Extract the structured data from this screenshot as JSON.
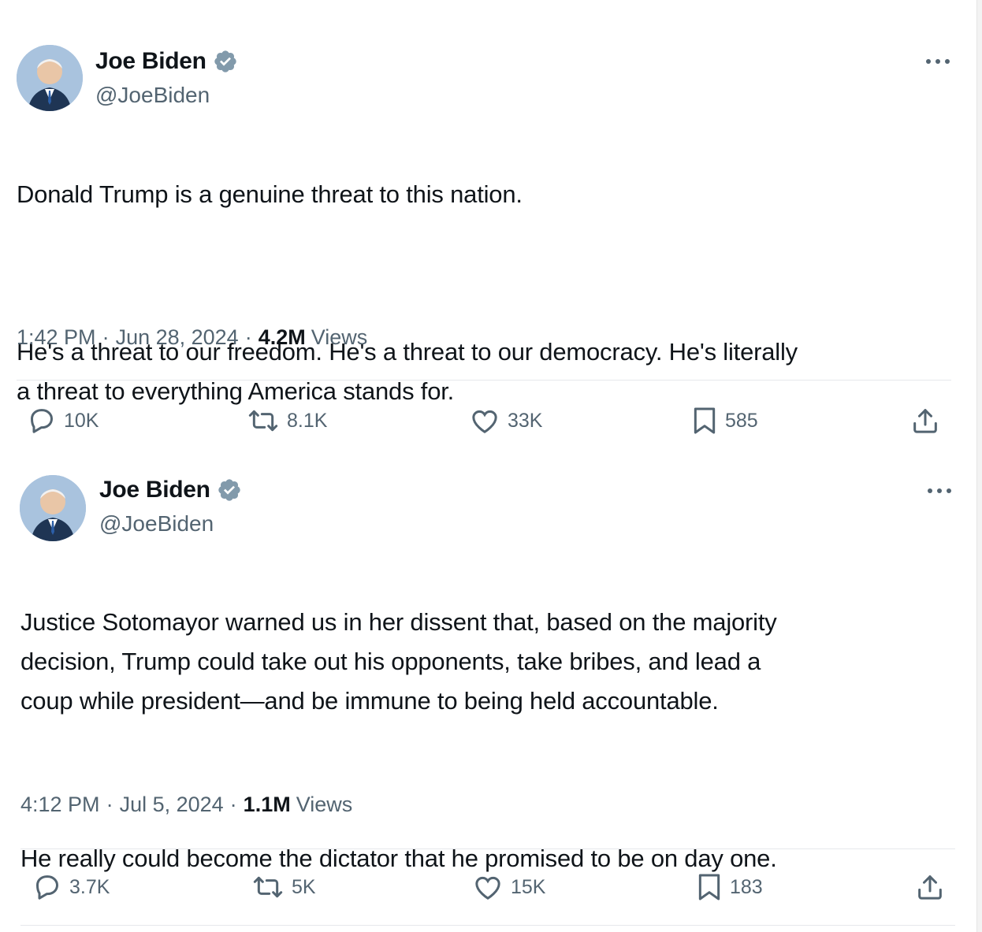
{
  "tweets": [
    {
      "author_name": "Joe Biden",
      "handle": "@JoeBiden",
      "paragraphs": [
        "Donald Trump is a genuine threat to this nation.",
        "He's a threat to our freedom. He's a threat to our democracy. He's literally\na threat to everything America stands for."
      ],
      "time": "1:42 PM",
      "date": "Jun 28, 2024",
      "views_count": "4.2M",
      "views_label": "Views",
      "replies": "10K",
      "reposts": "8.1K",
      "likes": "33K",
      "bookmarks": "585"
    },
    {
      "author_name": "Joe Biden",
      "handle": "@JoeBiden",
      "paragraphs": [
        "Justice Sotomayor warned us in her dissent that, based on the majority\ndecision, Trump could take out his opponents, take bribes, and lead a\ncoup while president—and be immune to being held accountable.",
        "He really could become the dictator that he promised to be on day one."
      ],
      "time": "4:12 PM",
      "date": "Jul 5, 2024",
      "views_count": "1.1M",
      "views_label": "Views",
      "replies": "3.7K",
      "reposts": "5K",
      "likes": "15K",
      "bookmarks": "183"
    }
  ],
  "icons": {
    "verified": "verified-badge-icon",
    "more": "more-icon",
    "reply": "reply-icon",
    "repost": "repost-icon",
    "like": "like-icon",
    "bookmark": "bookmark-icon",
    "share": "share-icon"
  },
  "colors": {
    "text_primary": "#0f1419",
    "text_secondary": "#536471",
    "divider": "#e6e8eb",
    "verified_badge": "#829aab"
  }
}
